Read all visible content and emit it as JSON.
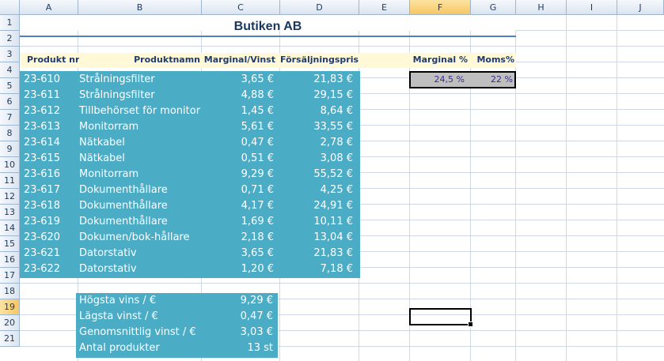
{
  "columns": [
    "A",
    "B",
    "C",
    "D",
    "E",
    "F",
    "G",
    "H",
    "I",
    "J"
  ],
  "rows": [
    "1",
    "2",
    "3",
    "4",
    "5",
    "6",
    "7",
    "8",
    "9",
    "10",
    "11",
    "12",
    "13",
    "14",
    "15",
    "16",
    "17",
    "18",
    "19",
    "20",
    "21"
  ],
  "selected_column": "F",
  "selected_row": "19",
  "title": "Butiken AB",
  "headers": {
    "product_nr": "Produkt nr",
    "product_name": "Produktnamn",
    "margin_profit": "Marginal/Vinst",
    "sales_price": "Försäljningspris",
    "margin_pct": "Marginal %",
    "vat_pct": "Moms%"
  },
  "rates": {
    "margin_pct": "24,5 %",
    "vat_pct": "22 %"
  },
  "products": [
    {
      "nr": "23-610",
      "name": "Strålningsfilter",
      "margin": "3,65 €",
      "price": "21,83 €"
    },
    {
      "nr": "23-611",
      "name": "Strålningsfilter",
      "margin": "4,88 €",
      "price": "29,15 €"
    },
    {
      "nr": "23-612",
      "name": "Tillbehörset för monitor",
      "margin": "1,45 €",
      "price": "8,64 €"
    },
    {
      "nr": "23-613",
      "name": "Monitorram",
      "margin": "5,61 €",
      "price": "33,55 €"
    },
    {
      "nr": "23-614",
      "name": "Nätkabel",
      "margin": "0,47 €",
      "price": "2,78 €"
    },
    {
      "nr": "23-615",
      "name": "Nätkabel",
      "margin": "0,51 €",
      "price": "3,08 €"
    },
    {
      "nr": "23-616",
      "name": "Monitorram",
      "margin": "9,29 €",
      "price": "55,52 €"
    },
    {
      "nr": "23-617",
      "name": "Dokumenthållare",
      "margin": "0,71 €",
      "price": "4,25 €"
    },
    {
      "nr": "23-618",
      "name": "Dokumenthållare",
      "margin": "4,17 €",
      "price": "24,91 €"
    },
    {
      "nr": "23-619",
      "name": "Dokumenthållare",
      "margin": "1,69 €",
      "price": "10,11 €"
    },
    {
      "nr": "23-620",
      "name": "Dokumen/bok-hållare",
      "margin": "2,18 €",
      "price": "13,04 €"
    },
    {
      "nr": "23-621",
      "name": "Datorstativ",
      "margin": "3,65 €",
      "price": "21,83 €"
    },
    {
      "nr": "23-622",
      "name": "Datorstativ",
      "margin": "1,20 €",
      "price": "7,18 €"
    }
  ],
  "summary": [
    {
      "label": "Högsta vins / €",
      "value": "9,29 €"
    },
    {
      "label": "Lägsta vinst / €",
      "value": "0,47 €"
    },
    {
      "label": "Genomsnittlig vinst / €",
      "value": "3,03 €"
    },
    {
      "label": "Antal produkter",
      "value": "13 st"
    }
  ]
}
